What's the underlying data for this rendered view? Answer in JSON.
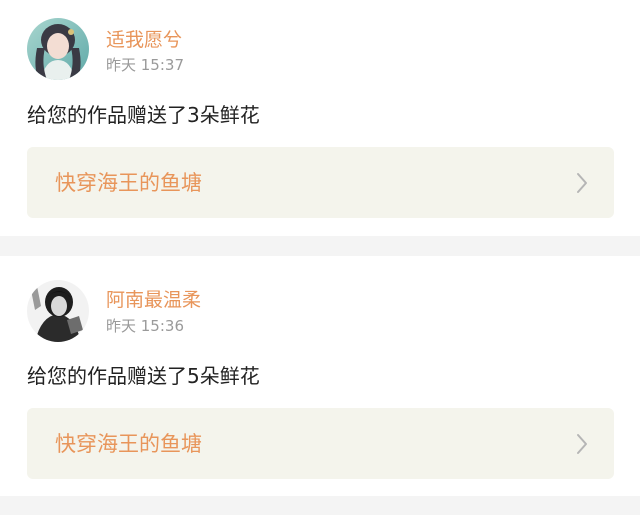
{
  "feed": {
    "items": [
      {
        "username": "适我愿兮",
        "timestamp": "昨天 15:37",
        "message": "给您的作品赠送了3朵鲜花",
        "work_title": "快穿海王的鱼塘"
      },
      {
        "username": "阿南最温柔",
        "timestamp": "昨天 15:36",
        "message": "给您的作品赠送了5朵鲜花",
        "work_title": "快穿海王的鱼塘"
      }
    ]
  },
  "colors": {
    "accent": "#e8955a",
    "timestamp": "#9a9a9a",
    "text": "#222222",
    "link_bg": "#f4f4ec",
    "page_bg": "#f4f4f4"
  },
  "icons": {
    "avatar_1": "user-avatar",
    "avatar_2": "user-avatar",
    "chevron": "chevron-right-icon"
  }
}
